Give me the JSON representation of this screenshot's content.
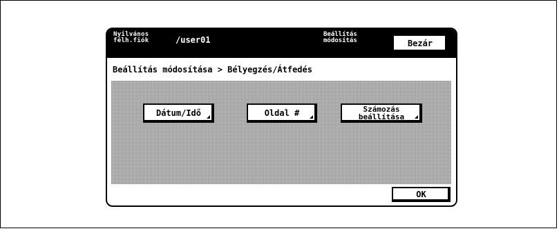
{
  "header": {
    "account_label": "Nyilvános\nfélh.fiók",
    "user": "/user01",
    "mode_label": "Beállítás\nmódosítás",
    "close_label": "Bezár"
  },
  "breadcrumb": "Beállítás módosítása > Bélyegzés/Átfedés",
  "buttons": {
    "date_time": "Dátum/Idő",
    "page_number": "Oldal #",
    "numbering_settings": "Számozás\nbeállítása"
  },
  "ok_label": "OK"
}
